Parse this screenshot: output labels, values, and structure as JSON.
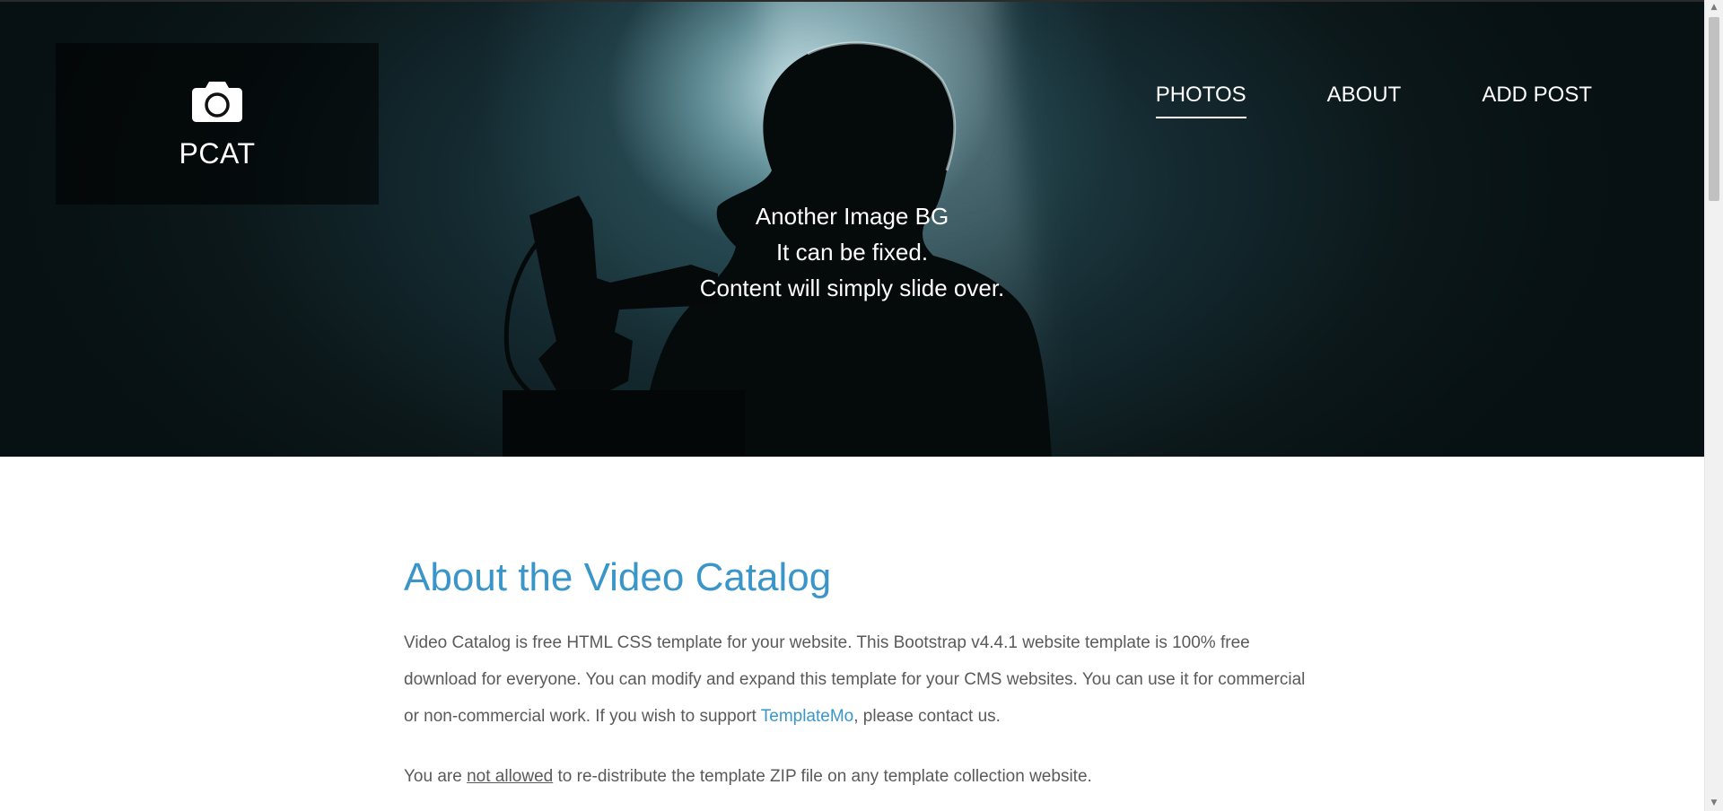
{
  "header": {
    "logo_icon": "camera-icon",
    "logo_text": "PCAT",
    "nav": [
      {
        "label": "PHOTOS",
        "active": true
      },
      {
        "label": "ABOUT",
        "active": false
      },
      {
        "label": "ADD POST",
        "active": false
      }
    ],
    "hero_lines": [
      "Another Image BG",
      "It can be fixed.",
      "Content will simply slide over."
    ]
  },
  "main": {
    "title": "About the Video Catalog",
    "paragraph1": {
      "text_before_link": "Video Catalog is free HTML CSS template for your website. This Bootstrap v4.4.1 website template is 100% free download for everyone. You can modify and expand this template for your CMS websites. You can use it for commercial or non-commercial work. If you wish to support ",
      "link_text": "TemplateMo",
      "text_after_link": ", please contact us."
    },
    "paragraph2": {
      "prefix": "You are ",
      "underlined": "not allowed",
      "suffix": " to re-distribute the template ZIP file on any template collection website."
    }
  },
  "scrollbar": {
    "up_icon": "scroll-up-arrow-icon",
    "down_icon": "scroll-down-arrow-icon"
  },
  "colors": {
    "accent": "#3a96c9",
    "body_text": "#5a5a5a",
    "logo_bg": "rgba(0,0,0,0.55)"
  }
}
